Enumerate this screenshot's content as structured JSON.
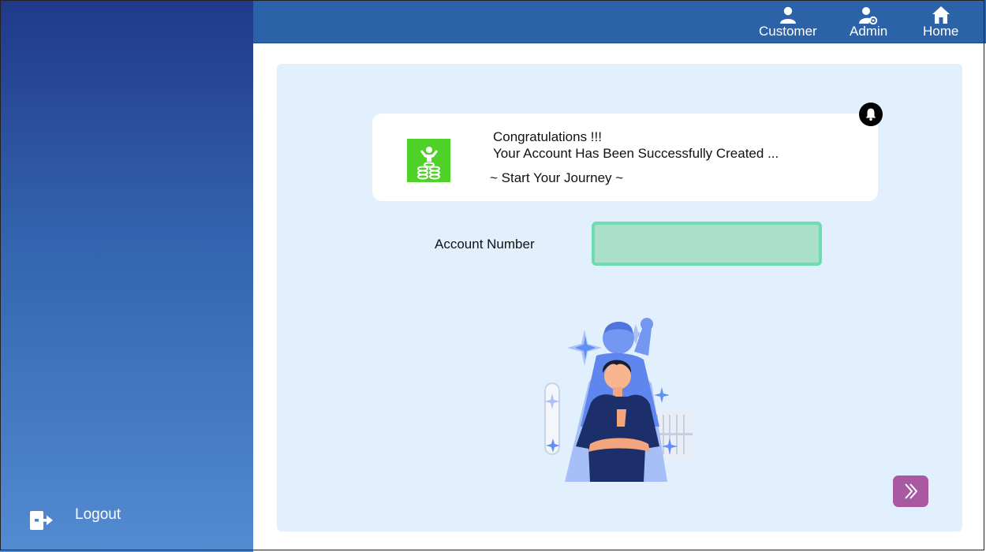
{
  "sidebar": {
    "logout_label": "Logout",
    "logout_icon": "logout-icon"
  },
  "topbar": {
    "nav": [
      {
        "label": "Customer",
        "icon": "customer-icon"
      },
      {
        "label": "Admin",
        "icon": "admin-icon"
      },
      {
        "label": "Home",
        "icon": "home-icon"
      }
    ]
  },
  "card": {
    "line1": "Congratulations !!!",
    "line2": "Your Account Has Been Successfully Created  ...",
    "line3": "~  Start Your Journey  ~",
    "logo_icon": "success-money-icon",
    "notification_icon": "bell-icon"
  },
  "account": {
    "label": "Account Number",
    "value": ""
  },
  "next_button_icon": "double-chevron-right-icon",
  "colors": {
    "sidebar_top": "#20398a",
    "sidebar_bottom": "#538bd1",
    "topbar": "#2c63a8",
    "panel": "#e2effd",
    "logo_green": "#4fd227",
    "input_fill": "#aadfc9",
    "input_border": "#6ddcb1",
    "next_button": "#a859a2"
  }
}
